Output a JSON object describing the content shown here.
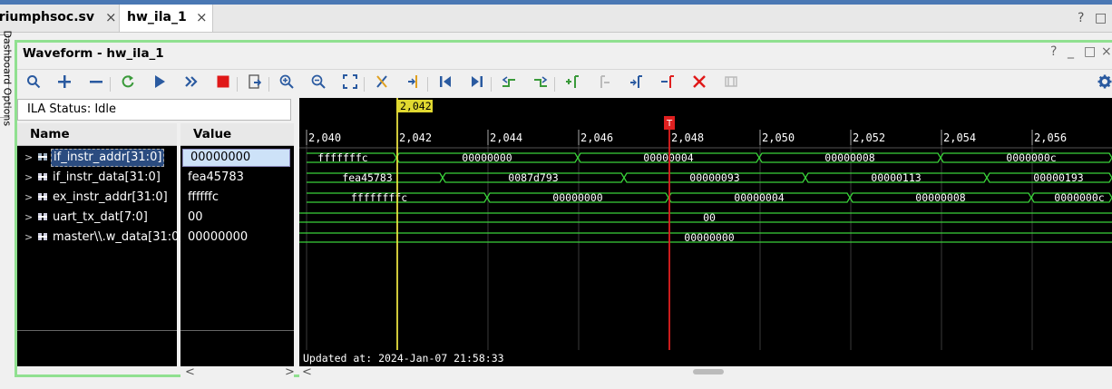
{
  "tabs": [
    {
      "label": "triumphsoc.sv",
      "active": false
    },
    {
      "label": "hw_ila_1",
      "active": true
    }
  ],
  "tab_controls": [
    "?",
    "□"
  ],
  "side_tab": "Dashboard Options",
  "panel": {
    "title": "Waveform - hw_ila_1",
    "controls": [
      "?",
      "_",
      "□",
      "×"
    ]
  },
  "toolbar": {
    "buttons": [
      "search",
      "zoom-in-add",
      "remove",
      "refresh",
      "run",
      "run-all",
      "stop",
      "export",
      "zoom-in",
      "zoom-out",
      "zoom-fit",
      "cursor-cut",
      "marker-add",
      "go-first",
      "go-last",
      "prev-transition",
      "next-transition",
      "add-marker",
      "prev-marker",
      "next-marker",
      "marker-goto",
      "delete-marker",
      "snap"
    ],
    "settings_icon": "gear-icon"
  },
  "ila_status": "ILA Status: Idle",
  "columns": {
    "name": "Name",
    "value": "Value"
  },
  "signals": [
    {
      "name": "if_instr_addr[31:0]",
      "value": "00000000",
      "selected": true
    },
    {
      "name": "if_instr_data[31:0]",
      "value": "fea45783",
      "selected": false
    },
    {
      "name": "ex_instr_addr[31:0]",
      "value": "ffffffc",
      "selected": false
    },
    {
      "name": "uart_tx_dat[7:0]",
      "value": "00",
      "selected": false
    },
    {
      "name": "master\\\\.w_data[31:0]",
      "value": "00000000",
      "selected": false
    }
  ],
  "waveform": {
    "cursor_label": "2,042",
    "trigger_label": "T",
    "ticks": [
      "2,040",
      "2,042",
      "2,044",
      "2,046",
      "2,048",
      "2,050",
      "2,052",
      "2,054",
      "2,056"
    ],
    "updated_at": "Updated at:  2024-Jan-07 21:58:33",
    "rows": [
      {
        "segments": [
          "fffffffc",
          "00000000",
          "00000004",
          "00000008",
          "0000000c"
        ]
      },
      {
        "segments": [
          "fea45783",
          "0087d793",
          "00000093",
          "00000113",
          "00000193"
        ]
      },
      {
        "segments": [
          "ffffffffc",
          "00000000",
          "00000004",
          "00000008",
          "0000000c"
        ]
      },
      {
        "segments": [
          "00"
        ]
      },
      {
        "segments": [
          "00000000"
        ]
      }
    ],
    "colors": {
      "wave": "#39d139",
      "cursor": "#e8e040",
      "trigger": "#e02020",
      "grid": "#3a3a3a"
    }
  },
  "scroll_left": "<",
  "scroll_right": ">"
}
